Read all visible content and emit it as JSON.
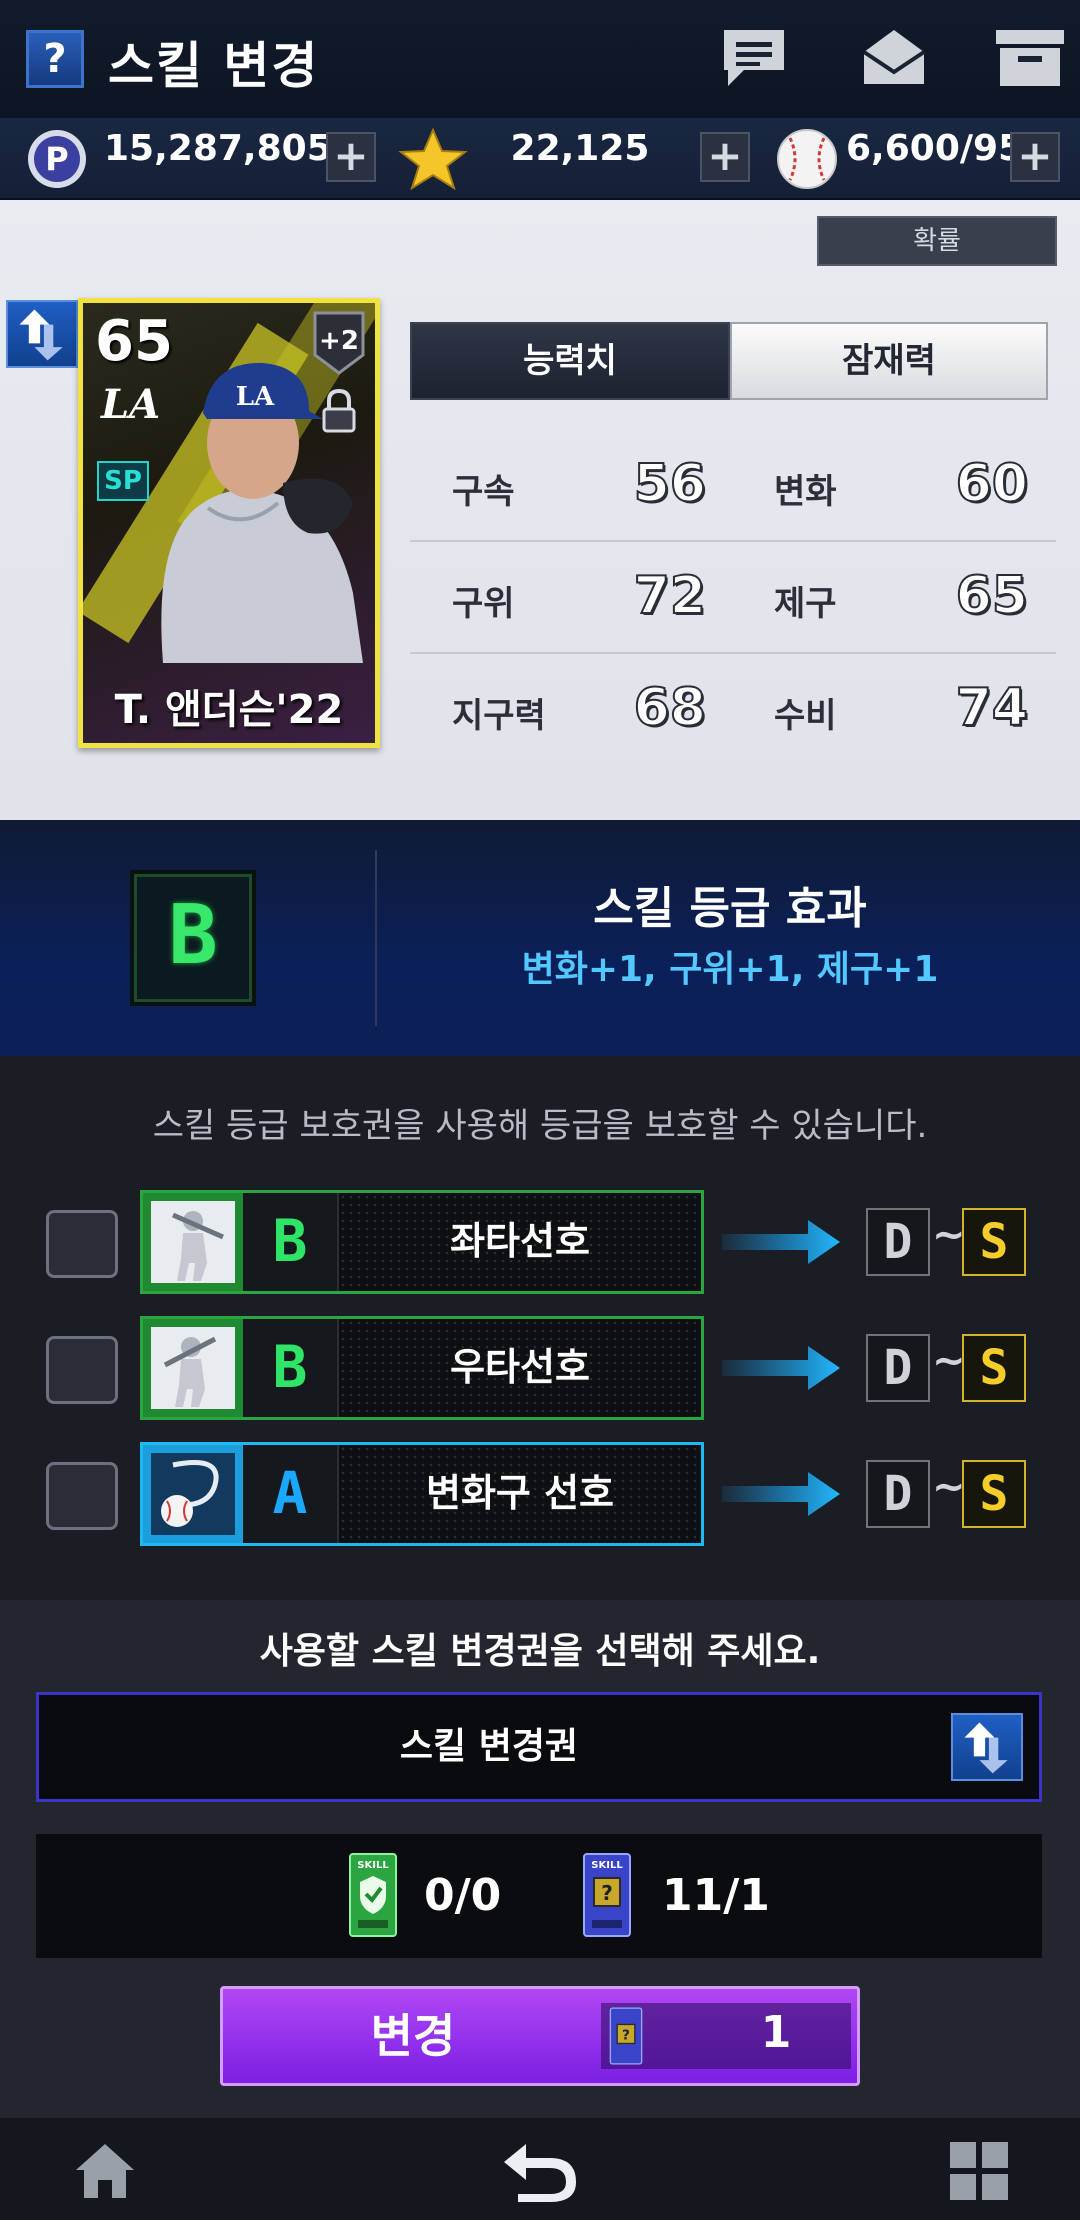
{
  "header": {
    "help_label": "?",
    "title": "스킬 변경",
    "icons": [
      "chat-icon",
      "mail-icon",
      "archive-icon"
    ]
  },
  "currency": {
    "points": "15,287,805",
    "stars": "22,125",
    "balls": "6,600/95",
    "plus_label": "+"
  },
  "panel": {
    "probability_label": "확률",
    "card": {
      "overall": "65",
      "team": "LA",
      "position": "SP",
      "enhancement": "+2",
      "name": "T. 앤더슨'22"
    },
    "tabs": [
      {
        "label": "능력치",
        "active": true
      },
      {
        "label": "잠재력",
        "active": false
      }
    ],
    "stats": [
      {
        "label": "구속",
        "value": "56"
      },
      {
        "label": "변화",
        "value": "60"
      },
      {
        "label": "구위",
        "value": "72"
      },
      {
        "label": "제구",
        "value": "65"
      },
      {
        "label": "지구력",
        "value": "68"
      },
      {
        "label": "수비",
        "value": "74"
      }
    ]
  },
  "grade_effect": {
    "grade": "B",
    "title": "스킬 등급 효과",
    "effect": "변화+1, 구위+1, 제구+1"
  },
  "skills": {
    "note": "스킬 등급 보호권을 사용해 등급을 보호할 수 있습니다.",
    "items": [
      {
        "grade": "B",
        "name": "좌타선호",
        "range_min": "D",
        "range_sep": "~",
        "range_max": "S",
        "icon": "left-batter-icon"
      },
      {
        "grade": "B",
        "name": "우타선호",
        "range_min": "D",
        "range_sep": "~",
        "range_max": "S",
        "icon": "right-batter-icon"
      },
      {
        "grade": "A",
        "name": "변화구 선호",
        "range_min": "D",
        "range_sep": "~",
        "range_max": "S",
        "icon": "breaking-ball-icon"
      }
    ]
  },
  "ticket": {
    "select_note": "사용할 스킬 변경권을 선택해 주세요.",
    "select_label": "스킬 변경권",
    "ticket_icon_label": "SKILL",
    "protect_count": "0/0",
    "change_count": "11/1",
    "change_button_label": "변경",
    "change_cost": "1"
  },
  "colors": {
    "accent_purple": "#9b35f0",
    "grade_green": "#2ee567",
    "grade_blue": "#1aa8ff",
    "grade_gold": "#f4cd2a",
    "card_border": "#f0e341"
  },
  "nav": {
    "icons": [
      "home-icon",
      "back-icon",
      "menu-grid-icon"
    ]
  }
}
